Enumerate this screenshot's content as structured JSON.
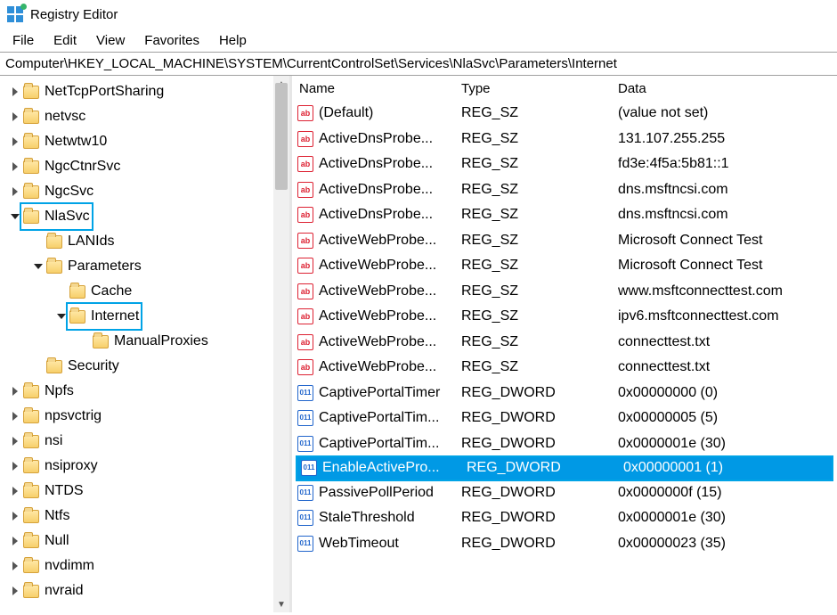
{
  "window": {
    "title": "Registry Editor"
  },
  "menu": {
    "file": "File",
    "edit": "Edit",
    "view": "View",
    "favorites": "Favorites",
    "help": "Help"
  },
  "address": {
    "path": "Computer\\HKEY_LOCAL_MACHINE\\SYSTEM\\CurrentControlSet\\Services\\NlaSvc\\Parameters\\Internet"
  },
  "tree": [
    {
      "label": "NetTcpPortSharing",
      "depth": 0,
      "exp": "closed"
    },
    {
      "label": "netvsc",
      "depth": 0,
      "exp": "closed"
    },
    {
      "label": "Netwtw10",
      "depth": 0,
      "exp": "closed"
    },
    {
      "label": "NgcCtnrSvc",
      "depth": 0,
      "exp": "closed"
    },
    {
      "label": "NgcSvc",
      "depth": 0,
      "exp": "closed"
    },
    {
      "label": "NlaSvc",
      "depth": 0,
      "exp": "open",
      "hl": true
    },
    {
      "label": "LANIds",
      "depth": 1,
      "exp": "none"
    },
    {
      "label": "Parameters",
      "depth": 1,
      "exp": "open"
    },
    {
      "label": "Cache",
      "depth": 2,
      "exp": "none"
    },
    {
      "label": "Internet",
      "depth": 2,
      "exp": "open",
      "hl": true
    },
    {
      "label": "ManualProxies",
      "depth": 3,
      "exp": "none"
    },
    {
      "label": "Security",
      "depth": 1,
      "exp": "none"
    },
    {
      "label": "Npfs",
      "depth": 0,
      "exp": "closed"
    },
    {
      "label": "npsvctrig",
      "depth": 0,
      "exp": "closed"
    },
    {
      "label": "nsi",
      "depth": 0,
      "exp": "closed"
    },
    {
      "label": "nsiproxy",
      "depth": 0,
      "exp": "closed"
    },
    {
      "label": "NTDS",
      "depth": 0,
      "exp": "closed"
    },
    {
      "label": "Ntfs",
      "depth": 0,
      "exp": "closed"
    },
    {
      "label": "Null",
      "depth": 0,
      "exp": "closed"
    },
    {
      "label": "nvdimm",
      "depth": 0,
      "exp": "closed"
    },
    {
      "label": "nvraid",
      "depth": 0,
      "exp": "closed"
    }
  ],
  "columns": {
    "name": "Name",
    "type": "Type",
    "data": "Data"
  },
  "values": [
    {
      "icon": "str",
      "name": "(Default)",
      "type": "REG_SZ",
      "data": "(value not set)"
    },
    {
      "icon": "str",
      "name": "ActiveDnsProbe...",
      "type": "REG_SZ",
      "data": "131.107.255.255"
    },
    {
      "icon": "str",
      "name": "ActiveDnsProbe...",
      "type": "REG_SZ",
      "data": "fd3e:4f5a:5b81::1"
    },
    {
      "icon": "str",
      "name": "ActiveDnsProbe...",
      "type": "REG_SZ",
      "data": "dns.msftncsi.com"
    },
    {
      "icon": "str",
      "name": "ActiveDnsProbe...",
      "type": "REG_SZ",
      "data": "dns.msftncsi.com"
    },
    {
      "icon": "str",
      "name": "ActiveWebProbe...",
      "type": "REG_SZ",
      "data": "Microsoft Connect Test"
    },
    {
      "icon": "str",
      "name": "ActiveWebProbe...",
      "type": "REG_SZ",
      "data": "Microsoft Connect Test"
    },
    {
      "icon": "str",
      "name": "ActiveWebProbe...",
      "type": "REG_SZ",
      "data": "www.msftconnecttest.com"
    },
    {
      "icon": "str",
      "name": "ActiveWebProbe...",
      "type": "REG_SZ",
      "data": "ipv6.msftconnecttest.com"
    },
    {
      "icon": "str",
      "name": "ActiveWebProbe...",
      "type": "REG_SZ",
      "data": "connecttest.txt"
    },
    {
      "icon": "str",
      "name": "ActiveWebProbe...",
      "type": "REG_SZ",
      "data": "connecttest.txt"
    },
    {
      "icon": "bin",
      "name": "CaptivePortalTimer",
      "type": "REG_DWORD",
      "data": "0x00000000 (0)"
    },
    {
      "icon": "bin",
      "name": "CaptivePortalTim...",
      "type": "REG_DWORD",
      "data": "0x00000005 (5)"
    },
    {
      "icon": "bin",
      "name": "CaptivePortalTim...",
      "type": "REG_DWORD",
      "data": "0x0000001e (30)"
    },
    {
      "icon": "bin",
      "name": "EnableActivePro...",
      "type": "REG_DWORD",
      "data": "0x00000001 (1)",
      "selected": true
    },
    {
      "icon": "bin",
      "name": "PassivePollPeriod",
      "type": "REG_DWORD",
      "data": "0x0000000f (15)"
    },
    {
      "icon": "bin",
      "name": "StaleThreshold",
      "type": "REG_DWORD",
      "data": "0x0000001e (30)"
    },
    {
      "icon": "bin",
      "name": "WebTimeout",
      "type": "REG_DWORD",
      "data": "0x00000023 (35)"
    }
  ]
}
